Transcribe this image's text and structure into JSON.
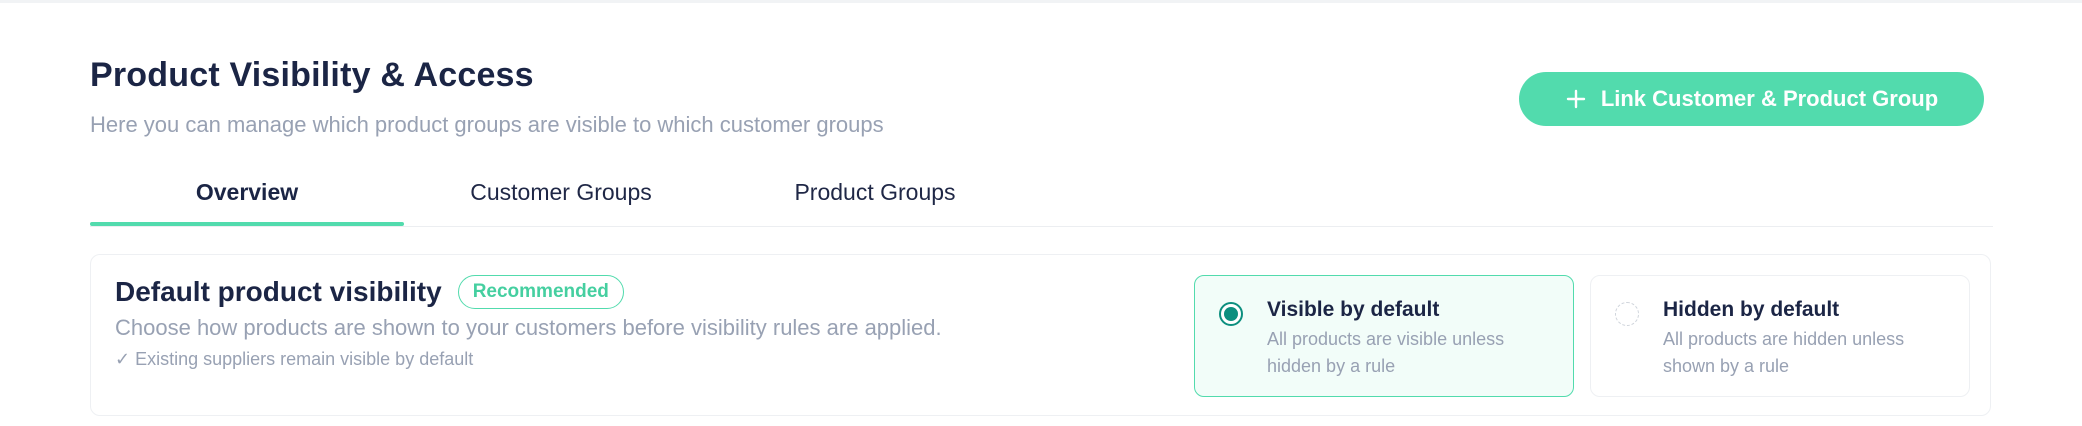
{
  "header": {
    "title": "Product Visibility & Access",
    "subtitle": "Here you can manage which product groups are visible to which customer groups",
    "link_button_label": "Link Customer & Product Group",
    "link_button_icon": "plus-icon"
  },
  "tabs": [
    {
      "label": "Overview",
      "active": true
    },
    {
      "label": "Customer Groups",
      "active": false
    },
    {
      "label": "Product Groups",
      "active": false
    }
  ],
  "default_visibility": {
    "title": "Default product visibility",
    "badge": "Recommended",
    "description": "Choose how products are shown to your customers before visibility rules are applied.",
    "note": "✓ Existing suppliers remain visible by default",
    "options": [
      {
        "title": "Visible by default",
        "description": "All products are visible unless hidden by a rule",
        "selected": true
      },
      {
        "title": "Hidden by default",
        "description": "All products are hidden unless shown by a rule",
        "selected": false
      }
    ]
  },
  "colors": {
    "accent": "#52dbad",
    "radio_selected": "#0d8f7f",
    "title_text": "#1b2545",
    "muted_text": "#98a1b3"
  }
}
